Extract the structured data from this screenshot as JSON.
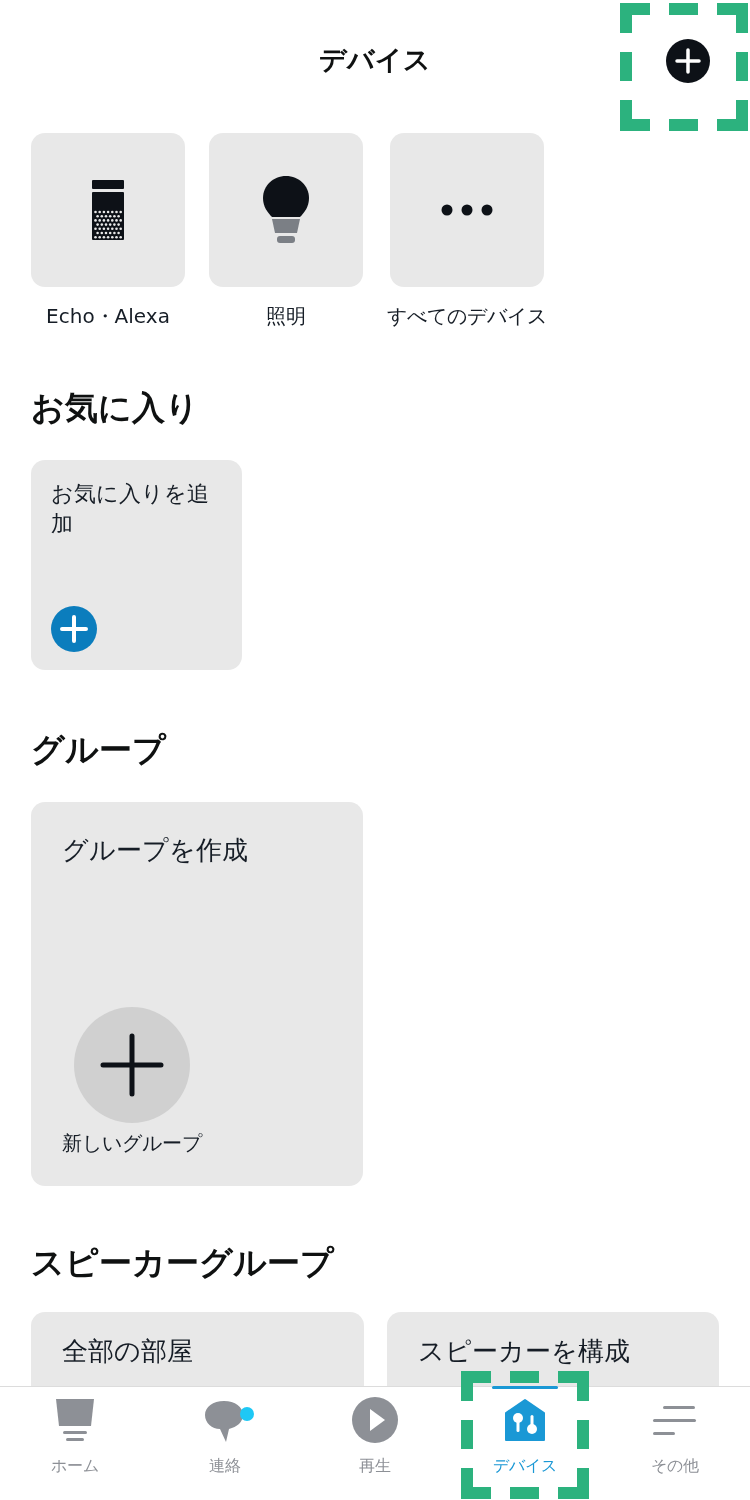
{
  "header": {
    "title": "デバイス",
    "add_button": {
      "highlighted": true
    }
  },
  "categories": [
    {
      "kind": "echo",
      "label": "Echo・Alexa"
    },
    {
      "kind": "light",
      "label": "照明"
    },
    {
      "kind": "all",
      "label": "すべてのデバイス"
    }
  ],
  "favorites": {
    "heading": "お気に入り",
    "add_card": {
      "label": "お気に入りを追加"
    }
  },
  "groups": {
    "heading": "グループ",
    "create_card": {
      "title": "グループを作成",
      "action_label": "新しいグループ"
    }
  },
  "speaker_groups": {
    "heading": "スピーカーグループ",
    "cards": [
      {
        "title": "全部の部屋"
      },
      {
        "title": "スピーカーを構成"
      }
    ]
  },
  "tabs": [
    {
      "kind": "home",
      "label": "ホーム",
      "selected": false,
      "notification": false,
      "highlighted": false
    },
    {
      "kind": "communicate",
      "label": "連絡",
      "selected": false,
      "notification": true,
      "highlighted": false
    },
    {
      "kind": "play",
      "label": "再生",
      "selected": false,
      "notification": false,
      "highlighted": false
    },
    {
      "kind": "devices",
      "label": "デバイス",
      "selected": true,
      "notification": false,
      "highlighted": true
    },
    {
      "kind": "more",
      "label": "その他",
      "selected": false,
      "notification": false,
      "highlighted": false
    }
  ]
}
